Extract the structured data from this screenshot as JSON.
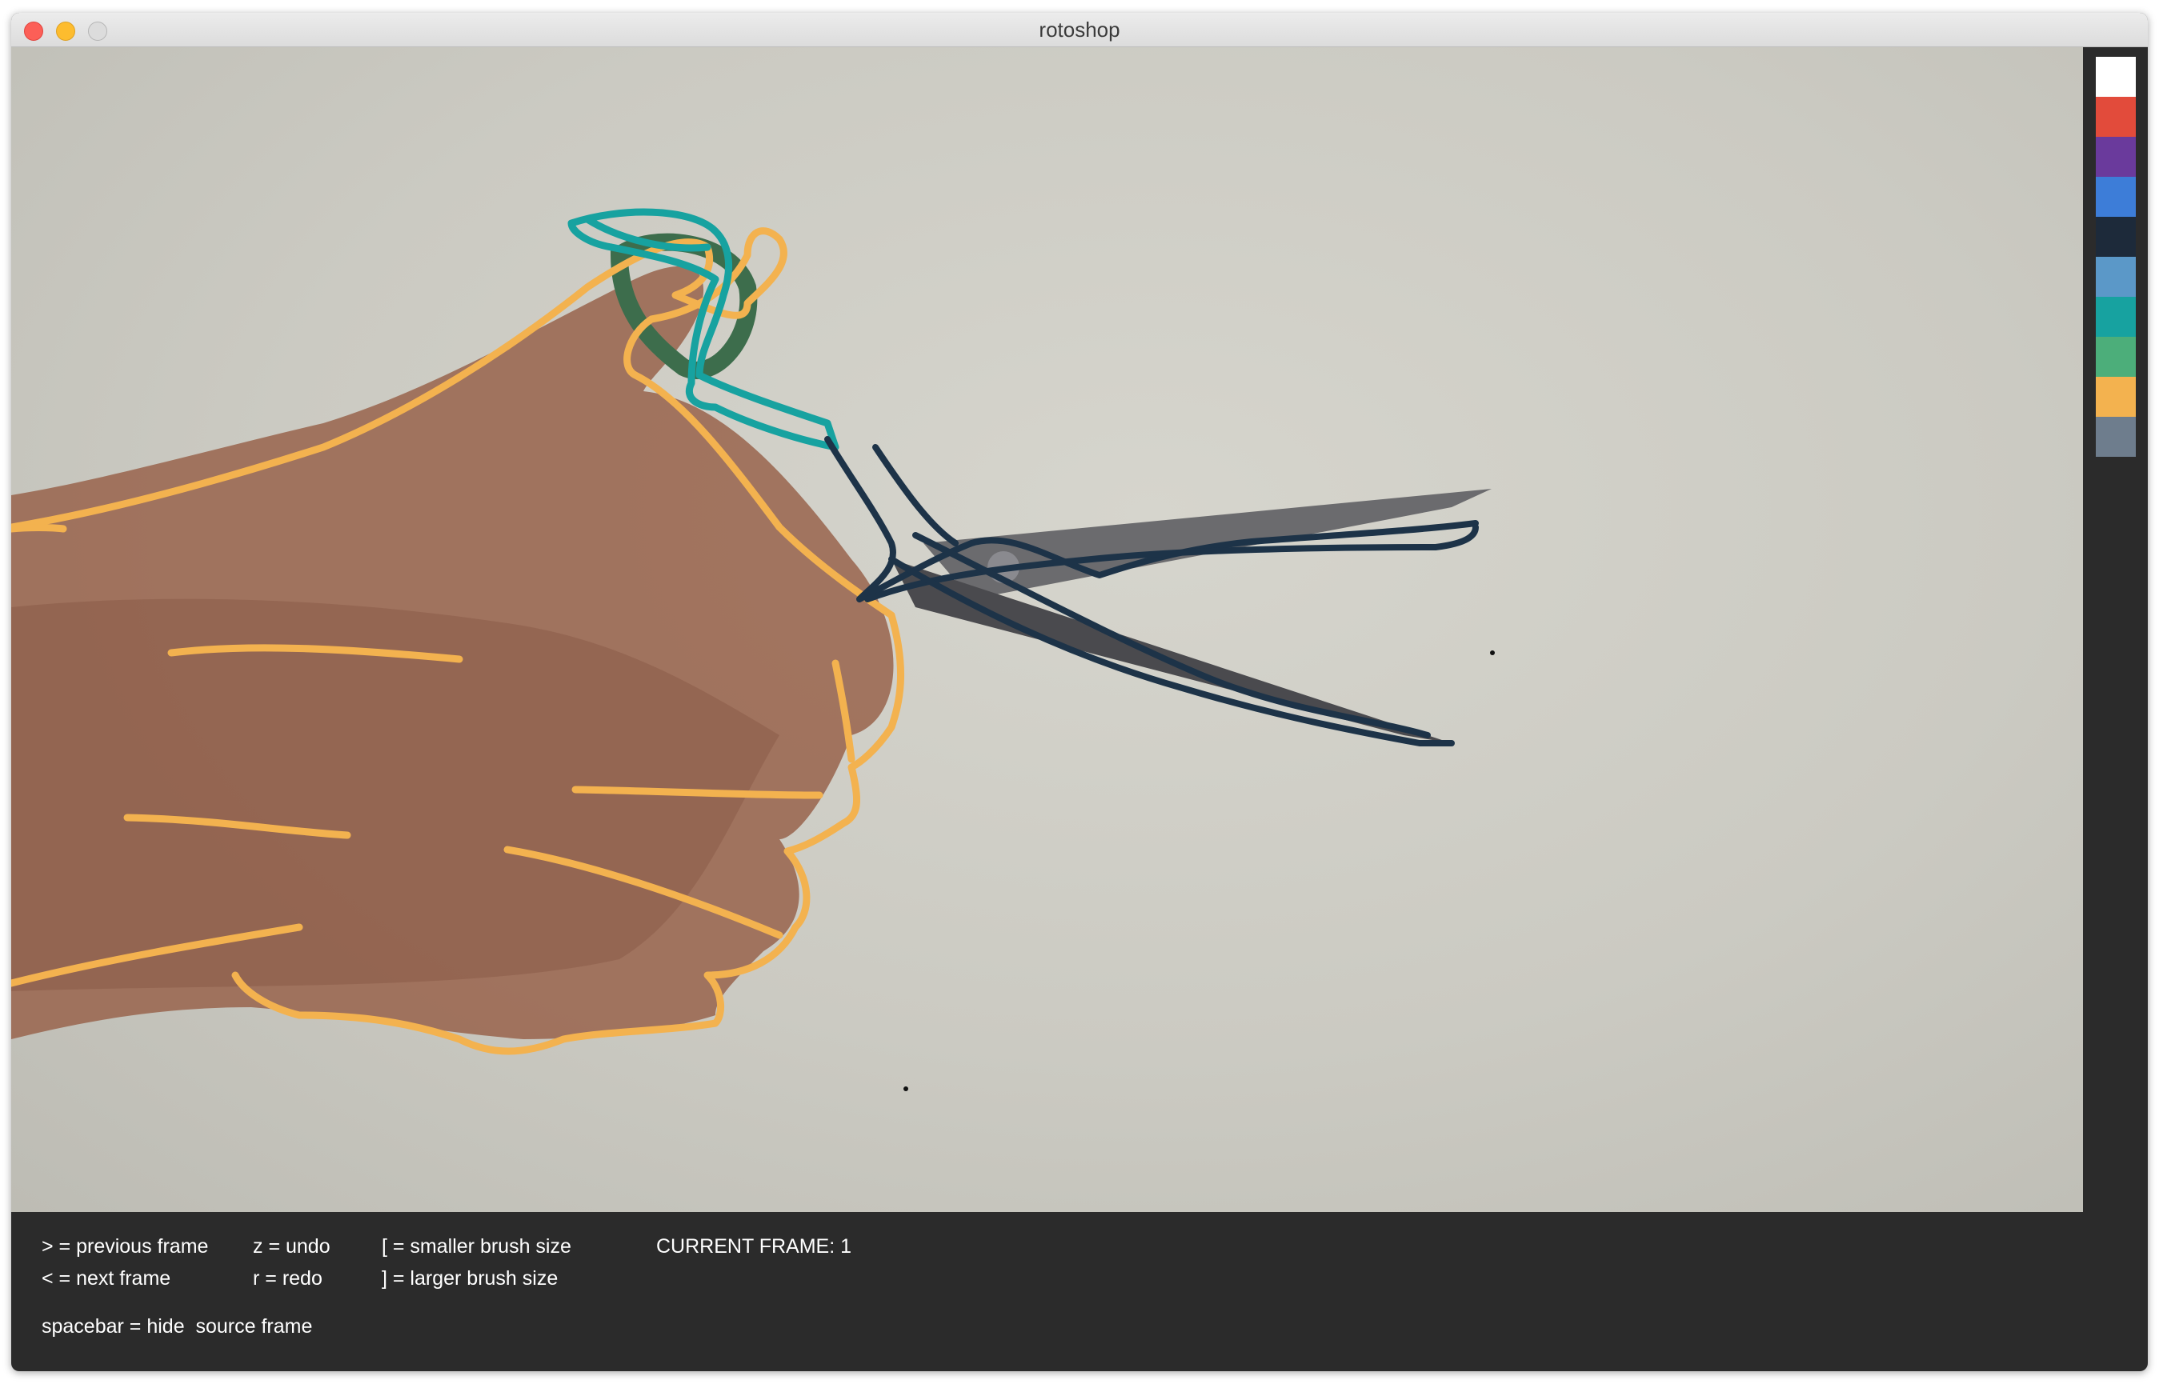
{
  "window": {
    "title": "rotoshop",
    "controls": [
      "close",
      "minimize",
      "zoom"
    ]
  },
  "palette": {
    "colors": [
      "#ffffff",
      "#e24b3b",
      "#6a3a9c",
      "#3d7dd8",
      "#1d2a3a",
      "#5b98c8",
      "#17a2a0",
      "#4cae7a",
      "#f3b24f",
      "#6e7d8d"
    ]
  },
  "help": {
    "prev_frame": "> = previous frame",
    "next_frame": "< = next frame",
    "undo": "z = undo",
    "redo": "r = redo",
    "smaller_brush": "[ = smaller brush size",
    "larger_brush": "] = larger brush size",
    "current_frame": "CURRENT FRAME: 1",
    "hide_source": "spacebar = hide  source frame"
  }
}
